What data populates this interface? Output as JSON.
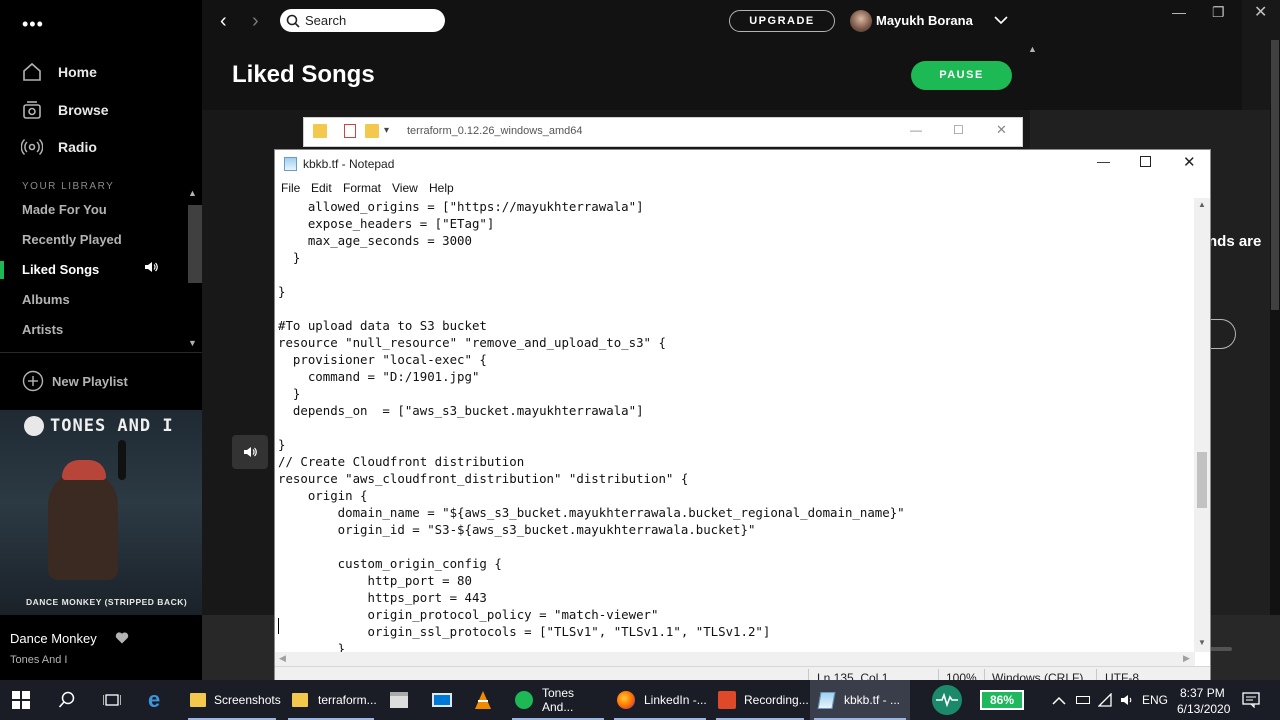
{
  "spotify": {
    "search_placeholder": "Search",
    "upgrade_label": "UPGRADE",
    "user_name": "Mayukh Borana",
    "page_title": "Liked Songs",
    "pause_label": "PAUSE",
    "nav": [
      {
        "label": "Home",
        "icon": "home-icon"
      },
      {
        "label": "Browse",
        "icon": "browse-icon"
      },
      {
        "label": "Radio",
        "icon": "radio-icon"
      }
    ],
    "library_header": "YOUR LIBRARY",
    "library": [
      "Made For You",
      "Recently Played",
      "Liked Songs",
      "Albums",
      "Artists"
    ],
    "new_playlist_label": "New Playlist",
    "album_art_artist": "TONES AND I",
    "album_art_title": "DANCE MONKEY (STRIPPED BACK)",
    "now_playing_title": "Dance Monkey",
    "now_playing_artist": "Tones And I",
    "right_peek_text": "nds are",
    "accent": "#1db954"
  },
  "explorer": {
    "title": "terraform_0.12.26_windows_amd64"
  },
  "notepad": {
    "title": "kbkb.tf - Notepad",
    "menu": [
      "File",
      "Edit",
      "Format",
      "View",
      "Help"
    ],
    "lines": [
      "    allowed_origins = [\"https://mayukhterrawala\"]",
      "    expose_headers = [\"ETag\"]",
      "    max_age_seconds = 3000",
      "  }",
      "",
      "}",
      "",
      "#To upload data to S3 bucket",
      "resource \"null_resource\" \"remove_and_upload_to_s3\" {",
      "  provisioner \"local-exec\" {",
      "    command = \"D:/1901.jpg\"",
      "  }",
      "  depends_on  = [\"aws_s3_bucket.mayukhterrawala\"]",
      "",
      "}",
      "// Create Cloudfront distribution",
      "resource \"aws_cloudfront_distribution\" \"distribution\" {",
      "    origin {",
      "        domain_name = \"${aws_s3_bucket.mayukhterrawala.bucket_regional_domain_name}\"",
      "        origin_id = \"S3-${aws_s3_bucket.mayukhterrawala.bucket}\"",
      "",
      "        custom_origin_config {",
      "            http_port = 80",
      "            https_port = 443",
      "            origin_protocol_policy = \"match-viewer\"",
      "            origin_ssl_protocols = [\"TLSv1\", \"TLSv1.1\", \"TLSv1.2\"]",
      "        }"
    ],
    "status": {
      "position": "Ln 135, Col 1",
      "zoom": "100%",
      "line_endings": "Windows (CRLF)",
      "encoding": "UTF-8"
    }
  },
  "taskbar": {
    "items": [
      {
        "label": "Screenshots",
        "icon": "folder-icon"
      },
      {
        "label": "terraform...",
        "icon": "folder-icon"
      },
      {
        "label": "Tones And...",
        "icon": "spotify-icon"
      },
      {
        "label": "LinkedIn -...",
        "icon": "firefox-icon"
      },
      {
        "label": "Recording...",
        "icon": "recording-icon"
      },
      {
        "label": "kbkb.tf - ...",
        "icon": "notepad-icon"
      }
    ],
    "battery": "86%",
    "language": "ENG",
    "time": "8:37 PM",
    "date": "6/13/2020"
  }
}
